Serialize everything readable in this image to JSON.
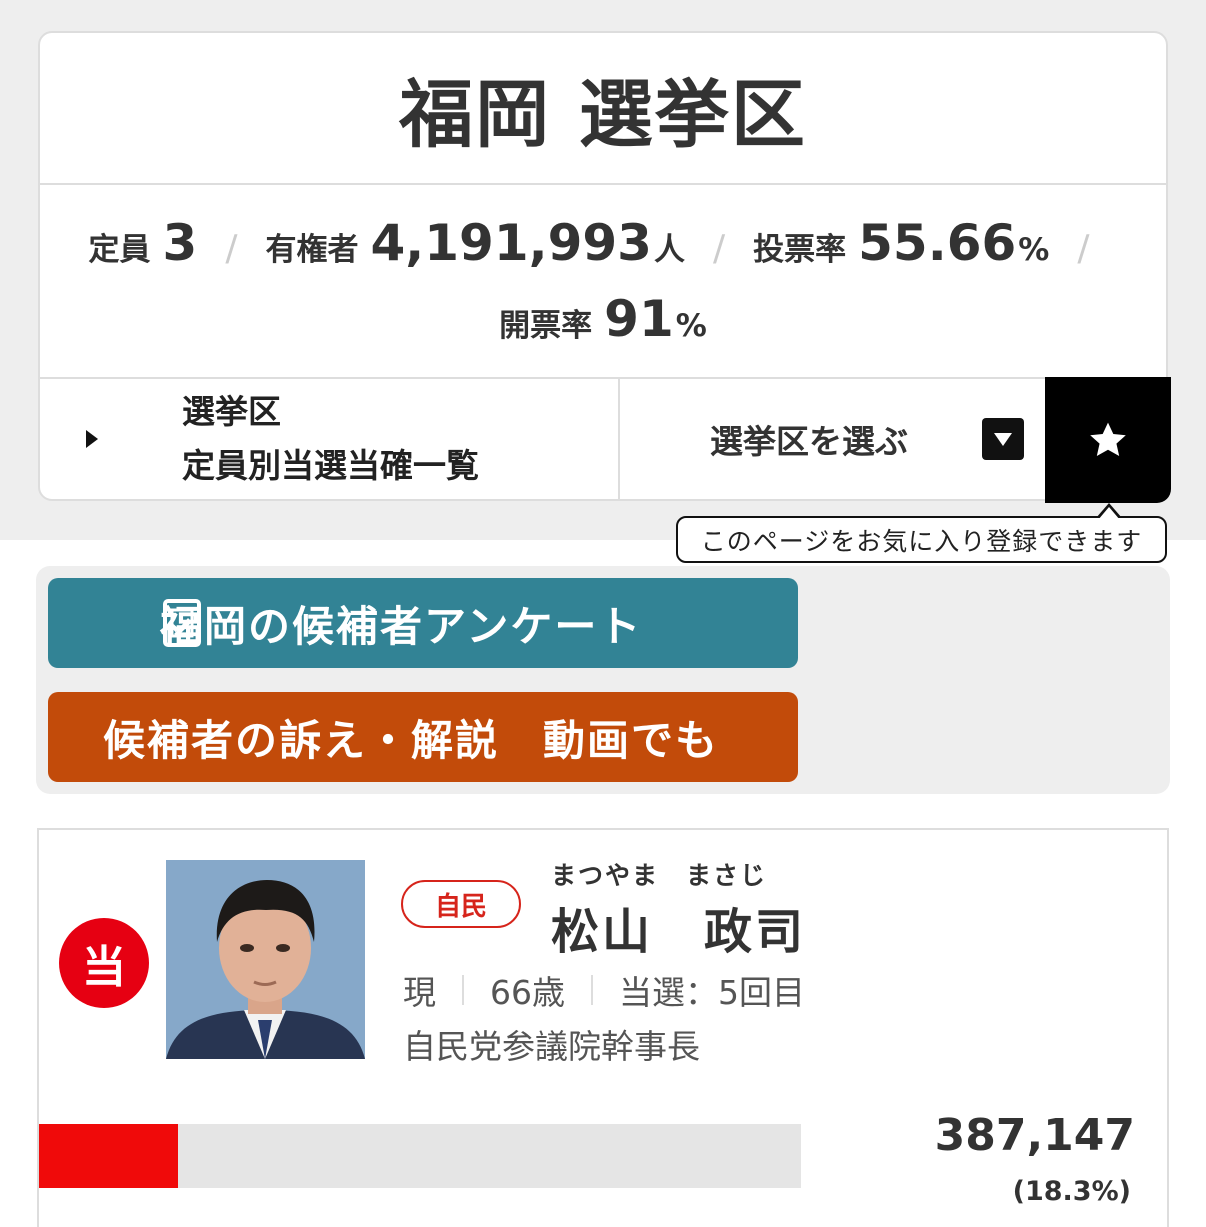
{
  "district": {
    "title": "福岡 選挙区"
  },
  "stats": {
    "seats_label": "定員",
    "seats_value": "3",
    "voters_label": "有権者",
    "voters_value": "4,191,993",
    "voters_unit": "人",
    "turnout_label": "投票率",
    "turnout_value": "55.66",
    "turnout_unit": "%",
    "counted_label": "開票率",
    "counted_value": "91",
    "counted_unit": "%",
    "separator": "/"
  },
  "controls": {
    "list_line1": "選挙区",
    "list_line2": "定員別当選当確一覧",
    "select_label": "選挙区を選ぶ",
    "favorite_icon": "star-icon",
    "tooltip": "このページをお気に入り登録できます"
  },
  "links": {
    "survey_label": "福岡の候補者アンケート",
    "survey_icon": "survey-icon",
    "video_label": "候補者の訴え・解説　動画でも",
    "survey_color": "#328395",
    "video_color": "#c24b0a"
  },
  "candidate": {
    "elected_badge": "当",
    "party": "自民",
    "furigana": "まつやま　まさじ",
    "name": "松山　政司",
    "status": "現",
    "age": "66歳",
    "terms": "当選：5回目",
    "role": "自民党参議院幹事長",
    "votes": "387,147",
    "vote_share_text": "(18.3%)",
    "vote_share": 0.183,
    "bar_color": "#f00a0a",
    "party_color": "#d6241b"
  }
}
